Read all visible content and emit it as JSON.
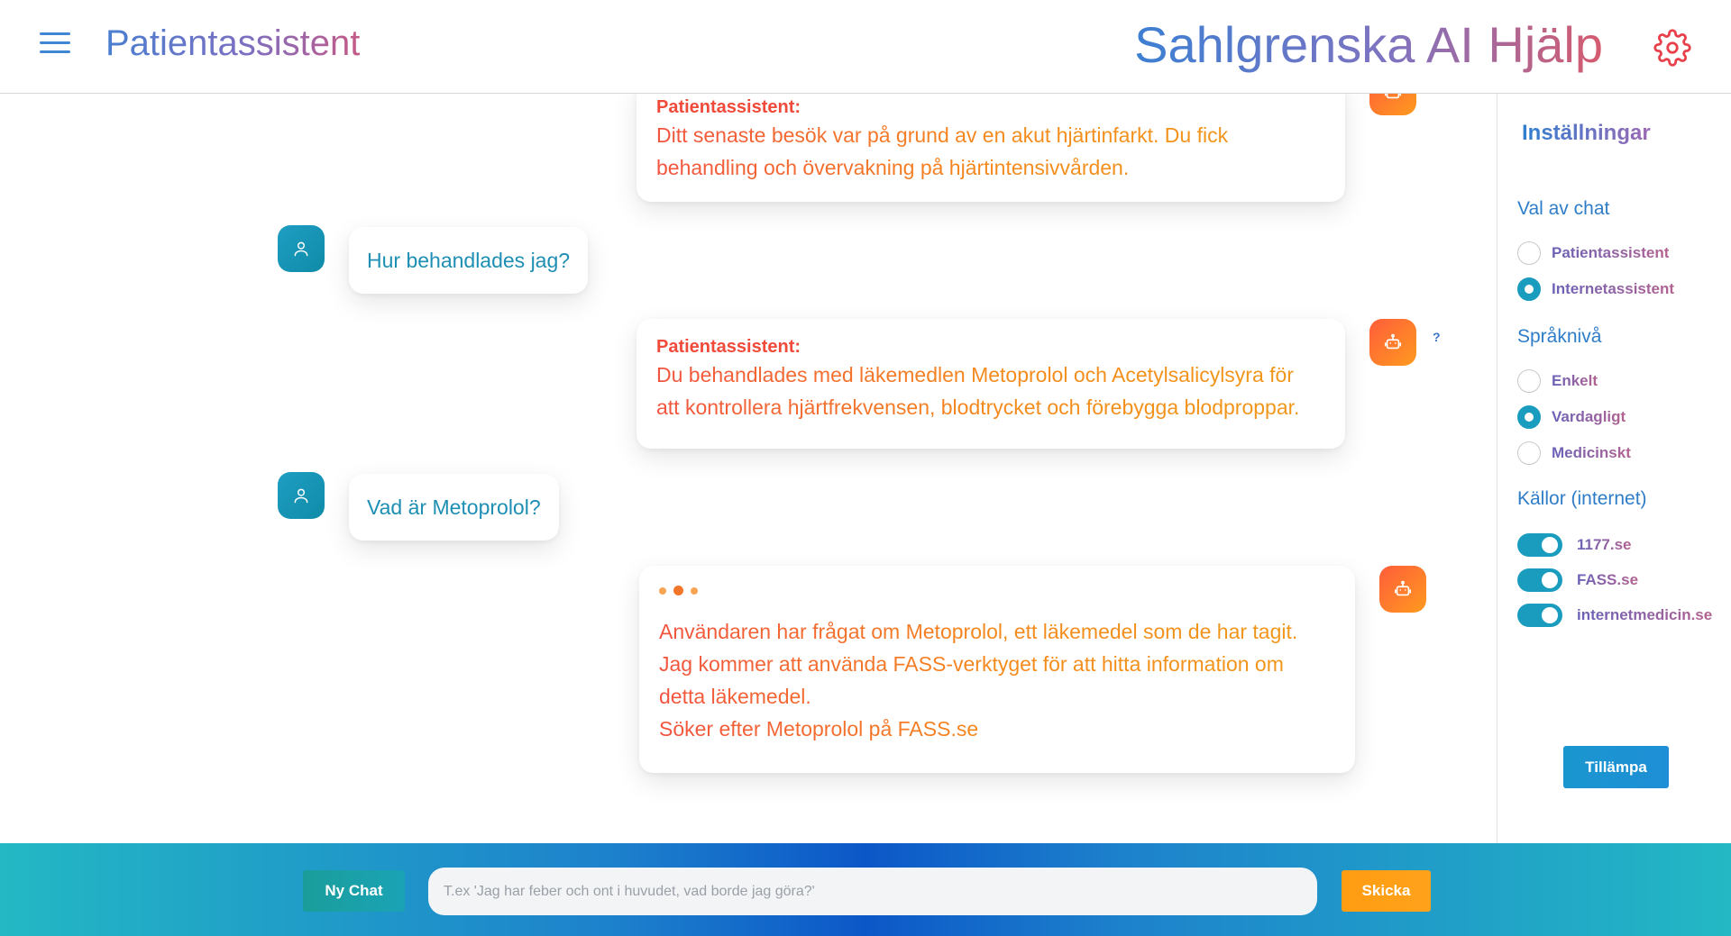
{
  "header": {
    "app_title": "Patientassistent",
    "brand_title": "Sahlgrenska AI Hjälp"
  },
  "icons": {
    "menu": "hamburger-icon",
    "settings": "gear-icon",
    "user_avatar": "user-icon",
    "bot_avatar": "robot-icon"
  },
  "chat": {
    "messages": [
      {
        "role": "bot",
        "sender": "Patientassistent:",
        "lines": [
          "Ditt senaste besök var på grund av en akut hjärtinfarkt. Du fick",
          "behandling och övervakning på hjärtintensivvården."
        ],
        "mark": "?"
      },
      {
        "role": "user",
        "text": "Hur behandlades jag?"
      },
      {
        "role": "bot",
        "sender": "Patientassistent:",
        "lines": [
          "Du behandlades med läkemedlen Metoprolol och Acetylsalicylsyra för",
          "att kontrollera hjärtfrekvensen, blodtrycket och förebygga blodproppar."
        ],
        "mark": "?"
      },
      {
        "role": "user",
        "text": "Vad är Metoprolol?"
      },
      {
        "role": "bot",
        "status": "thinking",
        "lines": [
          "Användaren har frågat om Metoprolol, ett läkemedel som de har tagit.",
          "Jag kommer att använda FASS-verktyget för att hitta information om",
          "detta läkemedel.",
          "Söker efter Metoprolol på FASS.se"
        ]
      }
    ]
  },
  "settings": {
    "title": "Inställningar",
    "chat_choice": {
      "label": "Val av chat",
      "options": [
        "Patientassistent",
        "Internetassistent"
      ],
      "selected": "Internetassistent"
    },
    "language_level": {
      "label": "Språknivå",
      "options": [
        "Enkelt",
        "Vardagligt",
        "Medicinskt"
      ],
      "selected": "Vardagligt"
    },
    "sources": {
      "label": "Källor (internet)",
      "items": [
        {
          "name": "1177.se",
          "enabled": true
        },
        {
          "name": "FASS.se",
          "enabled": true
        },
        {
          "name": "internetmedicin.se",
          "enabled": true
        }
      ]
    },
    "apply_label": "Tillämpa"
  },
  "footer": {
    "new_chat_label": "Ny Chat",
    "input_placeholder": "T.ex 'Jag har feber och ont i huvudet, vad borde jag göra?'",
    "input_value": "",
    "send_label": "Skicka"
  },
  "colors": {
    "accent_teal": "#1a9cbf",
    "accent_orange": "#ff9d12",
    "bot_text": "#f2533f",
    "user_text": "#1e8fb4"
  }
}
